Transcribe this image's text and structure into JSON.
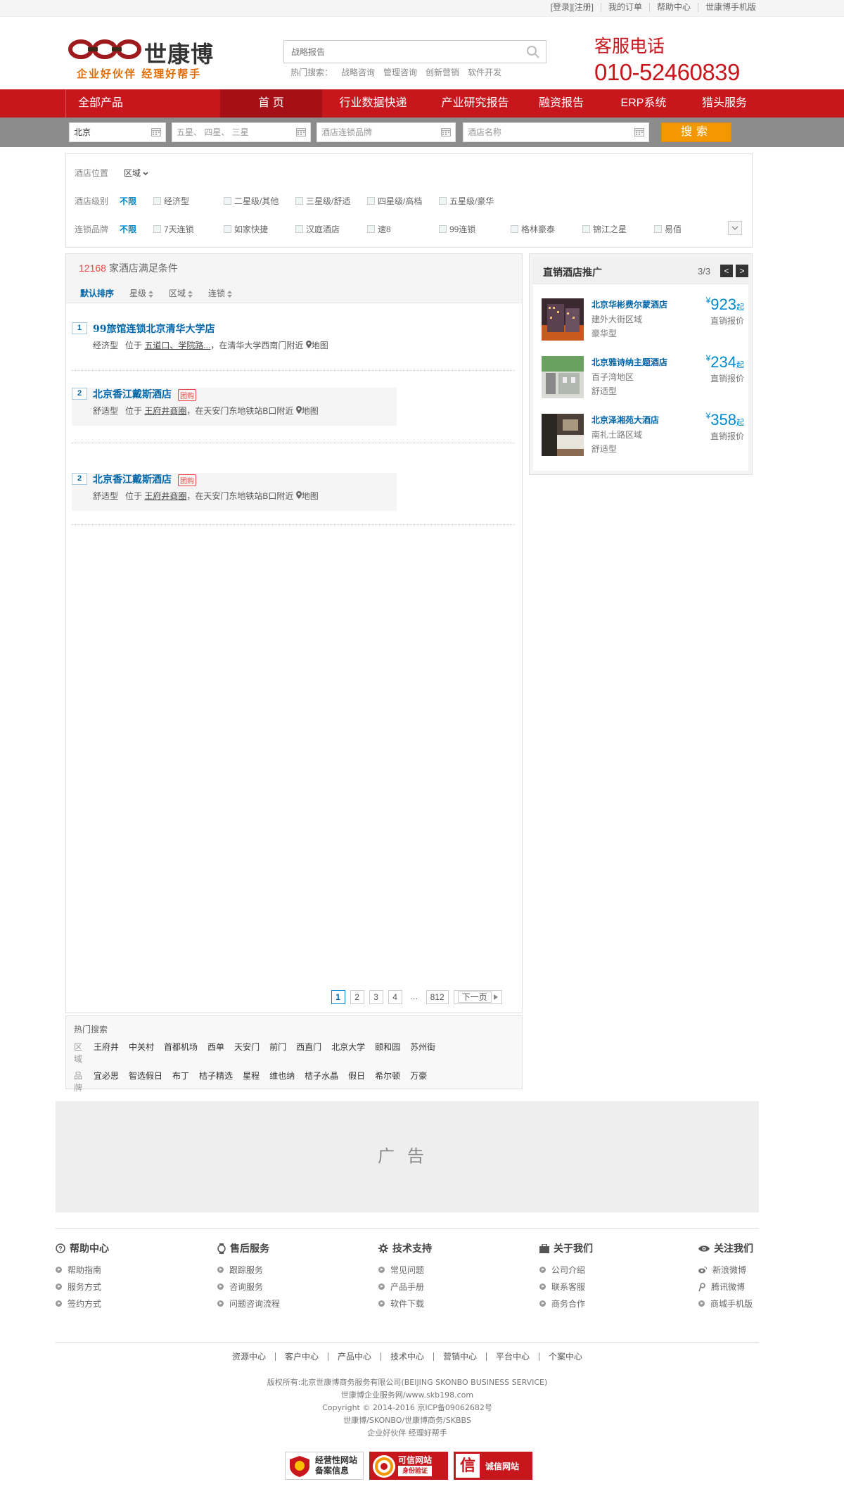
{
  "topbar": {
    "login": "[登录]",
    "register": "[注册]",
    "orders": "我的订单",
    "help": "帮助中心",
    "mobile": "世康博手机版"
  },
  "header": {
    "brand": "世康博",
    "slogan": "企业好伙伴  经理好帮手",
    "search_placeholder": "战略报告",
    "hot_label": "热门搜索：",
    "hot_items": [
      "战略咨询",
      "管理咨询",
      "创新营销",
      "软件开发"
    ],
    "hotline_label": "客服电话",
    "hotline_number": "010-52460839"
  },
  "nav": {
    "all": "全部产品",
    "items": [
      "首 页",
      "行业数据快递",
      "产业研究报告",
      "融资报告",
      "ERP系统",
      "猎头服务"
    ]
  },
  "filterbar": {
    "city": "北京",
    "stars": "五星、 四星、 三星",
    "brand_placeholder": "酒店连锁品牌",
    "name_placeholder": "酒店名称",
    "search_btn": "搜索"
  },
  "filters": {
    "location_label": "酒店位置",
    "location_value": "区域",
    "level_label": "酒店级别",
    "any": "不限",
    "levels": [
      "经济型",
      "二星级/其他",
      "三星级/舒适",
      "四星级/高档",
      "五星级/豪华"
    ],
    "chain_label": "连锁品牌",
    "chains": [
      "7天连锁",
      "如家快捷",
      "汉庭酒店",
      "速8",
      "99连锁",
      "格林豪泰",
      "锦江之星",
      "易佰"
    ]
  },
  "results": {
    "count": "12168",
    "count_suffix": " 家酒店满足条件",
    "sorts": [
      "默认排序",
      "星级",
      "区域",
      "连锁"
    ],
    "hotels": [
      {
        "no": "1",
        "name": "99旅馆连锁北京清华大学店",
        "tag": "",
        "level": "经济型",
        "pos": "位于",
        "loc": "五道口、学院路...",
        "near": "，在清华大学西南门附近",
        "map": "地图"
      },
      {
        "no": "2",
        "name": "北京香江戴斯酒店",
        "tag": "团购",
        "level": "舒适型",
        "pos": "位于",
        "loc": "王府井商圈",
        "near": "，在天安门东地铁站B口附近",
        "map": "地图"
      },
      {
        "no": "2",
        "name": "北京香江戴斯酒店",
        "tag": "团购",
        "level": "舒适型",
        "pos": "位于",
        "loc": "王府井商圈",
        "near": "，在天安门东地铁站B口附近",
        "map": "地图"
      }
    ],
    "pager": [
      "1",
      "2",
      "3",
      "4",
      "…",
      "812",
      "下一页"
    ]
  },
  "promo": {
    "title": "直销酒店推广",
    "page": "3/3",
    "prev": "<",
    "next": ">",
    "items": [
      {
        "name": "北京华彬费尔蒙酒店",
        "area": "建外大街区域",
        "level": "豪华型",
        "price": "923",
        "unit": "起",
        "yen": "¥",
        "price_label": "直销报价"
      },
      {
        "name": "北京雅诗纳主题酒店",
        "area": "百子湾地区",
        "level": "舒适型",
        "price": "234",
        "unit": "起",
        "yen": "¥",
        "price_label": "直销报价"
      },
      {
        "name": "北京泽湘苑大酒店",
        "area": "南礼士路区域",
        "level": "舒适型",
        "price": "358",
        "unit": "起",
        "yen": "¥",
        "price_label": "直销报价"
      }
    ]
  },
  "hotsearch": {
    "title": "热门搜索",
    "area_label": "区域",
    "areas": [
      "王府井",
      "中关村",
      "首都机场",
      "西单",
      "天安门",
      "前门",
      "西直门",
      "北京大学",
      "颐和园",
      "苏州街"
    ],
    "brand_label": "品牌",
    "brands": [
      "宜必思",
      "智选假日",
      "布丁",
      "桔子精选",
      "星程",
      "维也纳",
      "桔子水晶",
      "假日",
      "希尔顿",
      "万豪"
    ]
  },
  "ad": "广告",
  "footer": {
    "cols": [
      {
        "title": "帮助中心",
        "links": [
          "帮助指南",
          "服务方式",
          "签约方式"
        ]
      },
      {
        "title": "售后服务",
        "links": [
          "跟踪服务",
          "咨询服务",
          "问题咨询流程"
        ]
      },
      {
        "title": "技术支持",
        "links": [
          "常见问题",
          "产品手册",
          "软件下载"
        ]
      },
      {
        "title": "关于我们",
        "links": [
          "公司介绍",
          "联系客服",
          "商务合作"
        ]
      },
      {
        "title": "关注我们",
        "links": [
          "新浪微博",
          "腾讯微博",
          "商城手机版"
        ]
      }
    ],
    "links": [
      "资源中心",
      "客户中心",
      "产品中心",
      "技术中心",
      "营销中心",
      "平台中心",
      "个案中心"
    ],
    "copyright": [
      "版权所有:北京世康博商务服务有限公司(BEIJING SKONBO BUSINESS SERVICE)",
      "世康博企业服务网/www.skb198.com",
      "Copyright © 2014-2016 京ICP备09062682号",
      "世康博/SKONBO/世康博商务/SKBBS",
      "企业好伙伴 经理好帮手"
    ],
    "badges": [
      "经营性网站",
      "备案信息",
      "可信网站",
      "身份验证",
      "诚信网站"
    ]
  },
  "colors": {
    "brand_red": "#c8161d",
    "search_orange": "#f39800",
    "link_blue": "#0066aa"
  }
}
